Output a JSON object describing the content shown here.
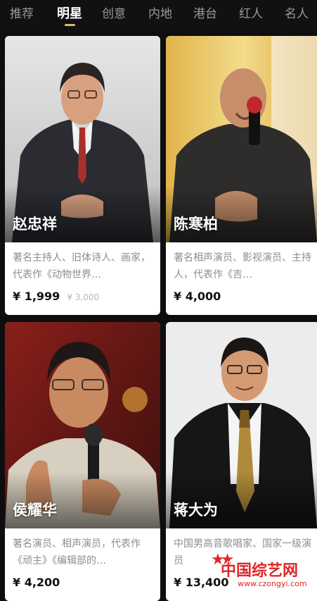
{
  "tabs": [
    "推荐",
    "明星",
    "创意",
    "内地",
    "港台",
    "红人",
    "名人"
  ],
  "active_tab_index": 1,
  "accent_color": "#e2b866",
  "cards": [
    {
      "name": "赵忠祥",
      "desc": "著名主持人、旧体诗人、画家，代表作《动物世界…",
      "price": "¥ 1,999",
      "price_old": "¥ 3,000"
    },
    {
      "name": "陈寒柏",
      "desc": "著名相声演员、影视演员、主持人，代表作《吉…",
      "price": "¥ 4,000",
      "price_old": ""
    },
    {
      "name": "侯耀华",
      "desc": "著名演员、相声演员，代表作《顽主》《编辑部的…",
      "price": "¥ 4,200",
      "price_old": ""
    },
    {
      "name": "蒋大为",
      "desc": "中国男高音歌唱家、国家一级演员",
      "price": "¥ 13,400",
      "price_old": ""
    }
  ],
  "watermark": {
    "title": "中国综艺网",
    "url": "www.czongyi.com"
  }
}
